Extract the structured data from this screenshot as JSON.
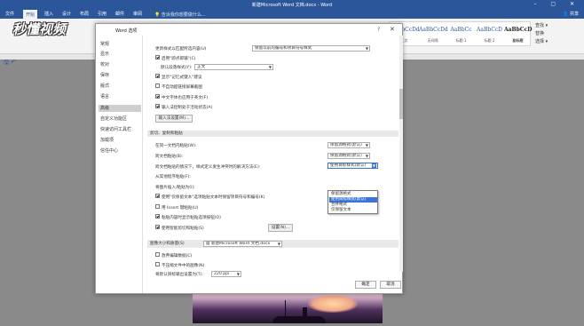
{
  "window": {
    "title": "新建Microsoft Word 文档.docx - Word",
    "controls": "– ▢ ✕"
  },
  "ribbon": {
    "tabs": [
      "文件",
      "开始",
      "插入",
      "设计",
      "布局",
      "引用",
      "邮件",
      "审阅",
      "视图",
      "帮助"
    ],
    "active_tab": "开始",
    "tell_me": "告诉我你想要做什么...",
    "share": "共享",
    "styles": [
      {
        "sample": "AaBbCcDd",
        "label": "正文"
      },
      {
        "sample": "AaBbCcDd",
        "label": "无间隔"
      },
      {
        "sample": "AaBbCc",
        "label": "标题 1"
      },
      {
        "sample": "AaBbCcD",
        "label": "标题 2"
      },
      {
        "sample": "AaBbCcD",
        "label": "副标题"
      }
    ],
    "editing": [
      "查找 ▾",
      "替换",
      "选择 ▾"
    ],
    "editing_group": "编辑"
  },
  "watermark": "秒懂视频",
  "dialog": {
    "title": "Word 选项",
    "help": "?",
    "close": "✕",
    "nav": [
      "常规",
      "显示",
      "校对",
      "保存",
      "版式",
      "语言",
      "高级",
      "自定义功能区",
      "快速访问工具栏",
      "加载项",
      "信任中心"
    ],
    "nav_active": "高级",
    "settings": {
      "ime_row": "更新样式以匹配所选内容(U)",
      "ime_select": "保留以前的编号和项目符号样式",
      "click_type": "启用\"即点即输\"(C)",
      "default_para": "默认段落样式(Y):",
      "default_para_value": "正文",
      "autocomplete": "显示\"记忆式键入\"建议",
      "no_auto_hyperlink": "不自动超链接屏幕截图",
      "chinese_font": "中文字体也应用于英文(F)",
      "ime_control": "输入法控制处于活动状态(A)",
      "ime_settings_btn": "输入法设置(M)..."
    },
    "cut_copy_paste": {
      "section": "剪切、复制和粘贴",
      "same_doc": "在同一文档内粘贴(W):",
      "same_doc_value": "保留源格式(默认)",
      "cross_doc": "跨文档粘贴(B):",
      "cross_doc_value": "保留源格式(默认)",
      "cross_doc_conflict": "跨文档粘贴的情况下，样式定义发生冲突时的解决方法(E):",
      "conflict_value": "使用目标样式(默认)",
      "other_programs": "从其他程序粘贴(F):",
      "insert_pictures": "将图片插入/粘贴为(I):",
      "keep_text_only": "使用\"仅保留文本\"选项粘贴文本时保留项目符号和编号(K)",
      "insert_key_paste": "用 Insert 键粘贴(U)",
      "show_paste_options": "粘贴内容时显示粘贴选项按钮(O)",
      "smart_cut": "使用智能剪切和粘贴(S)",
      "settings_btn": "设置(N)..."
    },
    "dropdown_options": [
      "保留源格式",
      "使用目标样式(默认)",
      "合并格式",
      "仅保留文本"
    ],
    "dropdown_highlight": 1,
    "image_size": {
      "label": "图像大小和质量(S)",
      "doc": "新建Microsoft Word 文档.docx",
      "discard_edit": "放弃编辑数据(C)",
      "no_compress": "不压缩文件中的图像(N)",
      "default_ppi_label": "将默认目标输出设置为(T):",
      "default_ppi": "220 ppi"
    },
    "ok": "确定",
    "cancel": "取消"
  }
}
